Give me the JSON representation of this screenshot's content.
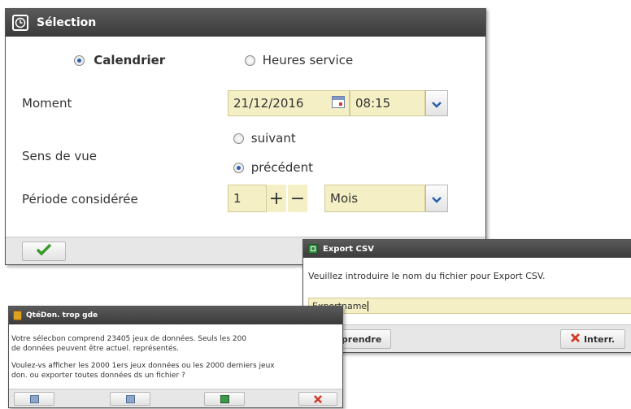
{
  "selection": {
    "title": "Sélection",
    "mode_calendar": "Calendrier",
    "mode_hours": "Heures service",
    "moment_label": "Moment",
    "date_value": "21/12/2016",
    "time_value": "08:15",
    "direction_label": "Sens de vue",
    "direction_next": "suivant",
    "direction_prev": "précédent",
    "period_label": "Période considérée",
    "period_value": "1",
    "period_unit": "Mois"
  },
  "export": {
    "title": "Export CSV",
    "prompt": "Veuillez introduire le nom du fichier pour Export CSV.",
    "filename": "Exportname",
    "resume_label": "Reprendre",
    "cancel_label": "Interr."
  },
  "toomuch": {
    "title": "QtéDon. trop gde",
    "line1": "Votre sélecbon comprend 23405 jeux de données. Seuls les 200",
    "line2": "de données peuvent être actuel. représentés.",
    "line3": "Voulez-vs afficher les 2000 1ers jeux données ou les 2000 derniers jeux",
    "line4": "don. ou exporter toutes données ds un fichier ?"
  },
  "colors": {
    "titlebar": "#444444",
    "field": "#f4efc4",
    "check": "#3a9a2a",
    "cancel": "#d23b2b"
  }
}
